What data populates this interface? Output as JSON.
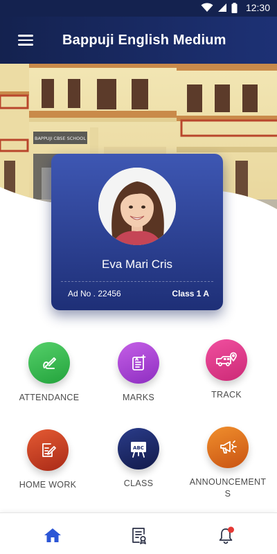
{
  "status_bar": {
    "time": "12:30"
  },
  "app_bar": {
    "title": "Bappuji English Medium"
  },
  "hero": {
    "school_sign": "BAPPUJI CBSE SCHOOL"
  },
  "student": {
    "name": "Eva Mari Cris",
    "admission_no": "Ad No . 22456",
    "class": "Class 1 A"
  },
  "menu": [
    {
      "label": "ATTENDANCE",
      "icon": "attendance-icon",
      "color": "#2fb34a"
    },
    {
      "label": "MARKS",
      "icon": "marks-icon",
      "color": "#a33cd0"
    },
    {
      "label": "TRACK",
      "icon": "bus-tracking-icon",
      "color": "#e03a8c"
    },
    {
      "label": "HOME WORK",
      "icon": "homework-icon",
      "color": "#c4391f"
    },
    {
      "label": "CLASS",
      "icon": "classboard-icon",
      "color": "#1d2c6e"
    },
    {
      "label": "ANNOUNCEMENTS",
      "icon": "megaphone-icon",
      "color": "#d86a15"
    }
  ],
  "bottom_nav": [
    {
      "icon": "home-icon",
      "active": true
    },
    {
      "icon": "report-icon",
      "active": false
    },
    {
      "icon": "notification-bell-icon",
      "active": false,
      "badge": true
    }
  ],
  "colors": {
    "primary": "#1d2c6e",
    "accent_active": "#2c56d6",
    "badge": "#e53935"
  }
}
